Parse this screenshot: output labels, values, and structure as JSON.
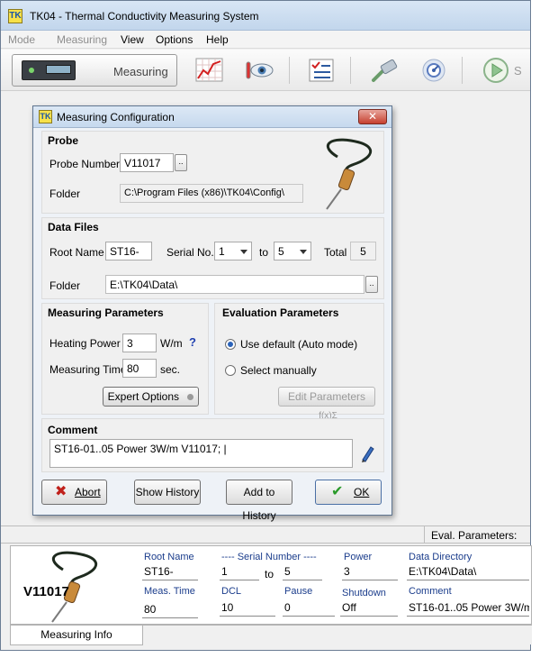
{
  "window": {
    "title": "TK04 - Thermal Conductivity Measuring System",
    "icon_glyph": "TK"
  },
  "menu": {
    "items": [
      {
        "label": "Mode",
        "enabled": false
      },
      {
        "label": "Measuring",
        "enabled": false
      },
      {
        "label": "View",
        "enabled": true
      },
      {
        "label": "Options",
        "enabled": true
      },
      {
        "label": "Help",
        "enabled": true
      }
    ]
  },
  "toolbar": {
    "measuring_label": "Measuring",
    "start_label_partial": "S",
    "icons": [
      "device-icon",
      "chart-icon",
      "eye-icon",
      "checklist-icon",
      "probe-connector-icon",
      "dial-icon",
      "play-icon"
    ]
  },
  "dialog": {
    "title": "Measuring Configuration",
    "close_glyph": "✕",
    "probe": {
      "title": "Probe",
      "number_label": "Probe Number",
      "number_value": "V11017",
      "browse_glyph": "..",
      "folder_label": "Folder",
      "folder_value": "C:\\Program Files (x86)\\TK04\\Config\\"
    },
    "data_files": {
      "title": "Data Files",
      "root_label": "Root Name",
      "root_value": "ST16-",
      "serial_label": "Serial No.",
      "serial_from": "1",
      "to_label": "to",
      "serial_to": "5",
      "total_label": "Total",
      "total_value": "5",
      "folder_label": "Folder",
      "folder_value": "E:\\TK04\\Data\\",
      "browse_glyph": ".."
    },
    "measuring_params": {
      "title": "Measuring Parameters",
      "heating_label": "Heating Power",
      "heating_value": "3",
      "heating_unit": "W/m",
      "help_glyph": "?",
      "time_label": "Measuring Time",
      "time_value": "80",
      "time_unit": "sec.",
      "expert_label": "Expert Options"
    },
    "evaluation_params": {
      "title": "Evaluation Parameters",
      "option_default": "Use default (Auto mode)",
      "option_manual": "Select manually",
      "selected": "default",
      "edit_label": "Edit Parameters",
      "edit_icon_glyph": "f(x)Σ"
    },
    "comment": {
      "title": "Comment",
      "value": "ST16-01..05 Power 3W/m V11017; |"
    },
    "buttons": {
      "abort": "Abort",
      "show_history": "Show History",
      "add_history": "Add to History",
      "ok": "OK"
    }
  },
  "status": {
    "eval_params_label": "Eval. Parameters:"
  },
  "info": {
    "probe_name": "V11017",
    "root_name_label": "Root Name",
    "root_name_value": "ST16-",
    "serial_label": "---- Serial Number ----",
    "serial_from": "1",
    "serial_to_label": "to",
    "serial_to": "5",
    "power_label": "Power",
    "power_value": "3",
    "data_dir_label": "Data Directory",
    "data_dir_value": "E:\\TK04\\Data\\",
    "meas_time_label": "Meas. Time",
    "meas_time_value": "80",
    "dcl_label": "DCL",
    "dcl_value": "10",
    "pause_label": "Pause",
    "pause_value": "0",
    "shutdown_label": "Shutdown",
    "shutdown_value": "Off",
    "comment_label": "Comment",
    "comment_value": "ST16-01..05 Power 3W/m"
  },
  "tabs": {
    "active": "Measuring Info"
  },
  "colors": {
    "accent_blue": "#1b3d8c",
    "check_green": "#2a9a2a",
    "abort_red": "#c0201a"
  }
}
